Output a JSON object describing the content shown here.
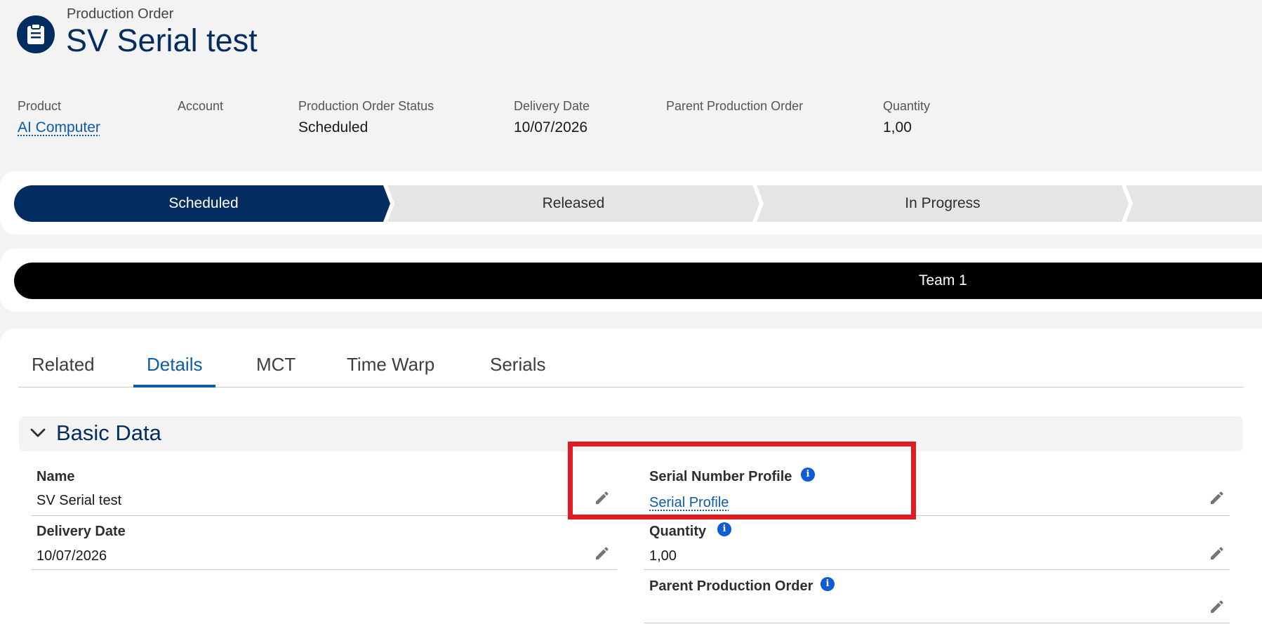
{
  "header": {
    "object_type": "Production Order",
    "record_title": "SV Serial test",
    "icon": "clipboard-icon"
  },
  "highlights": {
    "product": {
      "label": "Product",
      "value": "AI Computer"
    },
    "account": {
      "label": "Account",
      "value": ""
    },
    "status": {
      "label": "Production Order Status",
      "value": "Scheduled"
    },
    "delivery_date": {
      "label": "Delivery Date",
      "value": "10/07/2026"
    },
    "parent": {
      "label": "Parent Production Order",
      "value": ""
    },
    "quantity": {
      "label": "Quantity",
      "value": "1,00"
    }
  },
  "path": {
    "stages": [
      "Scheduled",
      "Released",
      "In Progress"
    ],
    "current": "Scheduled",
    "colors": {
      "active": "#032d60",
      "inactive": "#e5e5e5"
    }
  },
  "team": {
    "label": "Team 1"
  },
  "tabs": {
    "items": [
      "Related",
      "Details",
      "MCT",
      "Time Warp",
      "Serials"
    ],
    "active": "Details"
  },
  "section": {
    "title": "Basic Data"
  },
  "fields": {
    "name": {
      "label": "Name",
      "value": "SV Serial test"
    },
    "serial_profile": {
      "label": "Serial Number Profile",
      "value": "Serial Profile"
    },
    "delivery_date": {
      "label": "Delivery Date",
      "value": "10/07/2026"
    },
    "quantity": {
      "label": "Quantity",
      "value": "1,00"
    },
    "parent": {
      "label": "Parent Production Order",
      "value": ""
    }
  },
  "icons": {
    "info": "i",
    "edit": "pencil-icon",
    "section_toggle": "chevron-down-icon"
  },
  "annotation_color": "#e11b22"
}
